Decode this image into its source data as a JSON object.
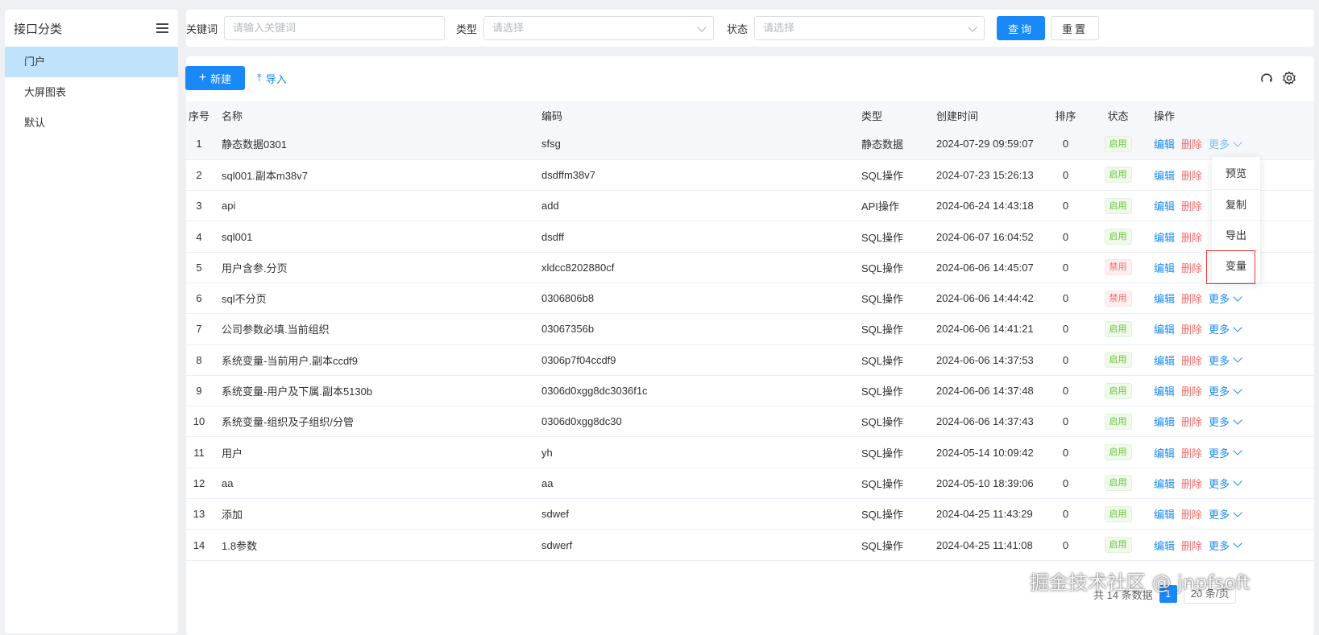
{
  "sidebar": {
    "title": "接口分类",
    "items": [
      {
        "label": "门户",
        "active": true
      },
      {
        "label": "大屏图表",
        "active": false
      },
      {
        "label": "默认",
        "active": false
      }
    ]
  },
  "filter": {
    "keyword_label": "关键词",
    "keyword_placeholder": "请输入关键词",
    "type_label": "类型",
    "type_placeholder": "请选择",
    "status_label": "状态",
    "status_placeholder": "请选择",
    "search_label": "查询",
    "reset_label": "重置"
  },
  "toolbar": {
    "new_label": "新建",
    "import_label": "导入"
  },
  "table": {
    "columns": [
      "序号",
      "名称",
      "编码",
      "类型",
      "创建时间",
      "排序",
      "状态",
      "操作"
    ],
    "edit_label": "编辑",
    "delete_label": "删除",
    "more_label": "更多",
    "rows": [
      {
        "no": "1",
        "name": "静态数据0301",
        "code": "sfsg",
        "type": "静态数据",
        "created": "2024-07-29 09:59:07",
        "sort": "0",
        "status": "启用"
      },
      {
        "no": "2",
        "name": "sql001.副本m38v7",
        "code": "dsdffm38v7",
        "type": "SQL操作",
        "created": "2024-07-23 15:26:13",
        "sort": "0",
        "status": "启用"
      },
      {
        "no": "3",
        "name": "api",
        "code": "add",
        "type": "API操作",
        "created": "2024-06-24 14:43:18",
        "sort": "0",
        "status": "启用"
      },
      {
        "no": "4",
        "name": "sql001",
        "code": "dsdff",
        "type": "SQL操作",
        "created": "2024-06-07 16:04:52",
        "sort": "0",
        "status": "启用"
      },
      {
        "no": "5",
        "name": "用户含参.分页",
        "code": "xldcc8202880cf",
        "type": "SQL操作",
        "created": "2024-06-06 14:45:07",
        "sort": "0",
        "status": "禁用"
      },
      {
        "no": "6",
        "name": "sql不分页",
        "code": "0306806b8",
        "type": "SQL操作",
        "created": "2024-06-06 14:44:42",
        "sort": "0",
        "status": "禁用"
      },
      {
        "no": "7",
        "name": "公司参数必填.当前组织",
        "code": "03067356b",
        "type": "SQL操作",
        "created": "2024-06-06 14:41:21",
        "sort": "0",
        "status": "启用"
      },
      {
        "no": "8",
        "name": "系统变量-当前用户.副本ccdf9",
        "code": "0306p7f04ccdf9",
        "type": "SQL操作",
        "created": "2024-06-06 14:37:53",
        "sort": "0",
        "status": "启用"
      },
      {
        "no": "9",
        "name": "系统变量-用户及下属.副本5130b",
        "code": "0306d0xgg8dc3036f1c",
        "type": "SQL操作",
        "created": "2024-06-06 14:37:48",
        "sort": "0",
        "status": "启用"
      },
      {
        "no": "10",
        "name": "系统变量-组织及子组织/分管",
        "code": "0306d0xgg8dc30",
        "type": "SQL操作",
        "created": "2024-06-06 14:37:43",
        "sort": "0",
        "status": "启用"
      },
      {
        "no": "11",
        "name": "用户",
        "code": "yh",
        "type": "SQL操作",
        "created": "2024-05-14 10:09:42",
        "sort": "0",
        "status": "启用"
      },
      {
        "no": "12",
        "name": "aa",
        "code": "aa",
        "type": "SQL操作",
        "created": "2024-05-10 18:39:06",
        "sort": "0",
        "status": "启用"
      },
      {
        "no": "13",
        "name": "添加",
        "code": "sdwef",
        "type": "SQL操作",
        "created": "2024-04-25 11:43:29",
        "sort": "0",
        "status": "启用"
      },
      {
        "no": "14",
        "name": "1.8参数",
        "code": "sdwerf",
        "type": "SQL操作",
        "created": "2024-04-25 11:41:08",
        "sort": "0",
        "status": "启用"
      }
    ]
  },
  "dropdown": {
    "items": [
      "预览",
      "复制",
      "导出",
      "变量"
    ]
  },
  "footer": {
    "total_text": "共 14 条数据",
    "page": "1",
    "page_size": "20 条/页"
  },
  "watermark": "掘金技术社区 @ jnpfsoft",
  "colors": {
    "primary": "#1989fa",
    "danger": "#f56c6c",
    "success": "#67c23a",
    "sidebar_active": "#bfe3fb"
  }
}
